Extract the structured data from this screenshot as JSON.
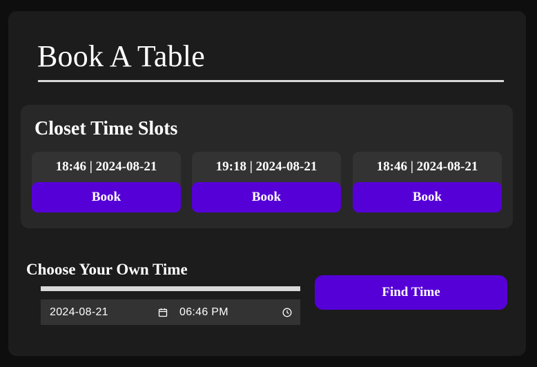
{
  "page": {
    "title": "Book A Table"
  },
  "slots_panel": {
    "heading": "Closet Time Slots",
    "slots": [
      {
        "time_label": "18:46 | 2024-08-21",
        "button_label": "Book"
      },
      {
        "time_label": "19:18 | 2024-08-21",
        "button_label": "Book"
      },
      {
        "time_label": "18:46 | 2024-08-21",
        "button_label": "Book"
      }
    ]
  },
  "custom_time": {
    "heading": "Choose Your Own Time",
    "date_value": "2024-08-21",
    "time_value": "06:46 PM",
    "date_icon": "calendar-icon",
    "time_icon": "clock-icon",
    "find_button_label": "Find Time"
  },
  "colors": {
    "accent": "#5600d8",
    "card_background": "#1c1c1c",
    "panel_background": "#282828",
    "page_background": "#0e0e0e"
  }
}
